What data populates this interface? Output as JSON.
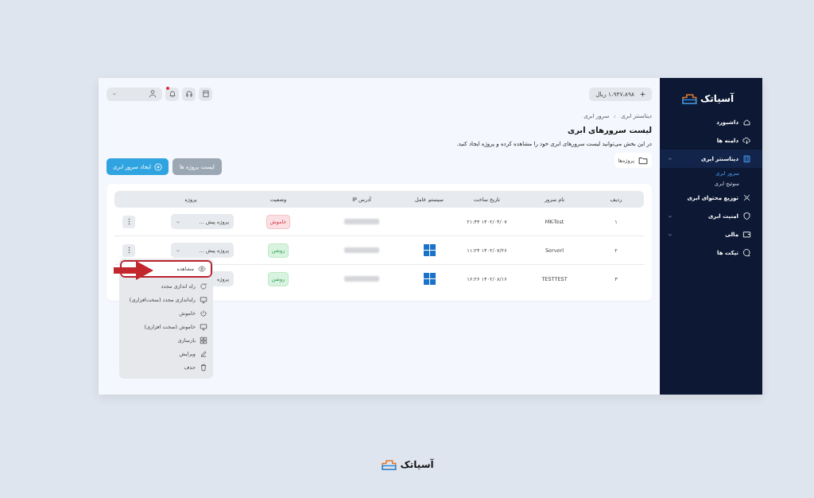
{
  "brand": {
    "logo_text": "آسیاتک"
  },
  "sidebar": {
    "items": [
      {
        "label": "داشبورد",
        "selected": false
      },
      {
        "label": "دامنه ها",
        "selected": false
      },
      {
        "label": "دیتاسنتر ابری",
        "expanded": true,
        "selected": true,
        "children": [
          {
            "label": "سرور ابری",
            "selected": true
          },
          {
            "label": "سوئیچ ابری",
            "selected": false
          }
        ]
      },
      {
        "label": "توزیع محتوای ابری",
        "selected": false
      },
      {
        "label": "امنیت ابری",
        "expanded": false,
        "selected": false
      },
      {
        "label": "مالی",
        "expanded": false,
        "selected": false
      },
      {
        "label": "تیکت ها",
        "selected": false
      }
    ]
  },
  "header": {
    "balance": "۱،۹۴۷،۸۹۸ ریال",
    "notifications": true
  },
  "breadcrumb": [
    "دیتاسنتر ابری",
    "سرور ابری"
  ],
  "page": {
    "title": "لیست سرورهای ابری",
    "description": "در این بخش می‌توانید لیست سرورهای ابری خود را مشاهده کرده و پروژه ایجاد کنید.",
    "projects_button": "پروژه‌ها",
    "create_button": "ایجاد سرور ابری",
    "list_button": "لیست پروژه ها"
  },
  "table": {
    "columns": [
      "ردیف",
      "نام سرور",
      "تاریخ ساخت",
      "سیستم عامل",
      "آدرس IP",
      "وضعیت",
      "پروژه"
    ],
    "rows": [
      {
        "index": "۱",
        "name": "MK-Test",
        "created": "۱۴۰۲/۰۴/۰۷ ۲۱:۴۴",
        "status": "خاموش",
        "on": false,
        "project": "پروژه پیش ..."
      },
      {
        "index": "۲",
        "name": "Serverl",
        "created": "۱۴۰۲/۰۷/۲۶ ۱۱:۲۴",
        "kind": "windows",
        "status": "روشن",
        "on": true,
        "project": "پروژه پیش ..."
      },
      {
        "index": "۳",
        "name": "TESTTEST",
        "created": "۱۴۰۲/۰۸/۱۶ ۱۶:۲۶",
        "kind": "windows",
        "status": "روشن",
        "on": true,
        "project": "پروژه"
      }
    ]
  },
  "row_menu": {
    "items": [
      {
        "label": "مشاهده",
        "selected": true
      },
      {
        "label": "راه اندازی مجدد",
        "selected": false
      },
      {
        "label": "راه‌اندازی مجدد (سخت‌افزاری)",
        "selected": false
      },
      {
        "label": "خاموش",
        "selected": false
      },
      {
        "label": "خاموش (سخت افزاری)",
        "selected": false
      },
      {
        "label": "بازسازی",
        "selected": false
      },
      {
        "label": "ویرایش",
        "selected": false
      },
      {
        "label": "حذف",
        "selected": false
      }
    ]
  },
  "footer": {
    "logo_text": "آسیاتک"
  }
}
